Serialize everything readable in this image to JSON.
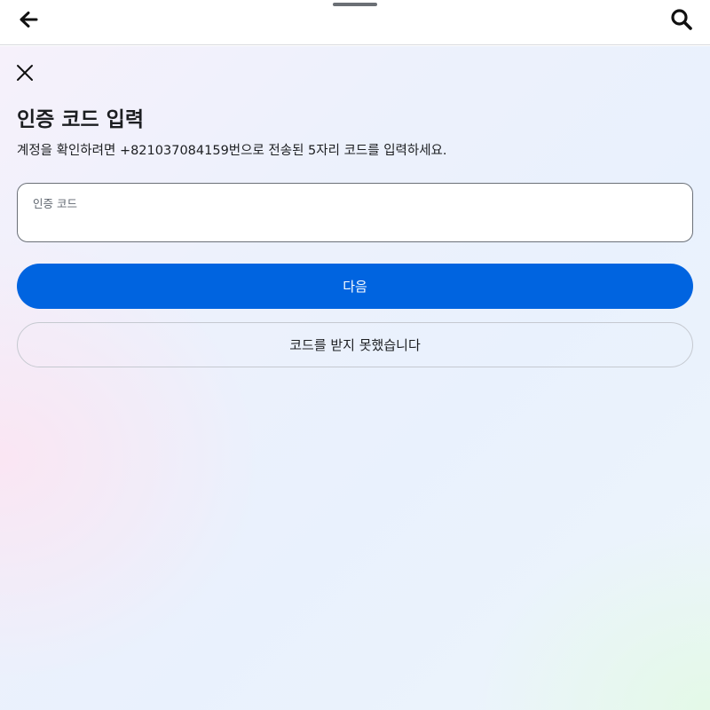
{
  "header": {
    "back_icon": "arrow-left-icon",
    "search_icon": "search-icon"
  },
  "dialog": {
    "close_icon": "close-icon",
    "title": "인증 코드 입력",
    "subtitle": "계정을 확인하려면 +821037084159번으로 전송된 5자리 코드를 입력하세요.",
    "code_field": {
      "label": "인증 코드",
      "value": ""
    },
    "next_button": "다음",
    "resend_button": "코드를 받지 못했습니다"
  },
  "colors": {
    "primary": "#0064e0",
    "text": "#1c1e21",
    "field_border": "#6b7078"
  }
}
